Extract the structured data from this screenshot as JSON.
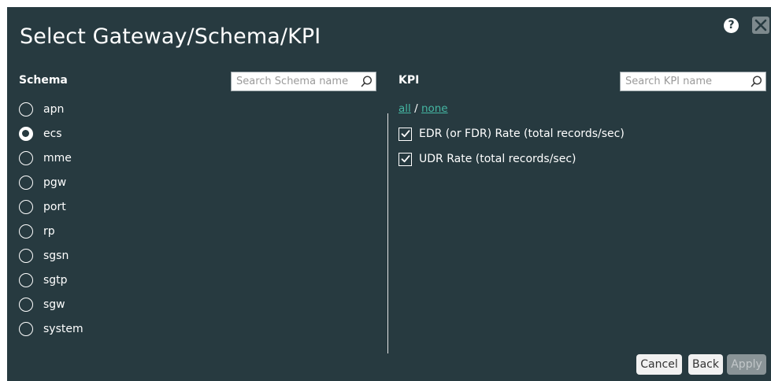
{
  "dialog": {
    "title": "Select Gateway/Schema/KPI",
    "help_icon": "question-circle-icon",
    "close_icon": "close-x-icon"
  },
  "schema": {
    "label": "Schema",
    "search_placeholder": "Search Schema name",
    "search_icon": "magnifier-icon",
    "options": [
      "apn",
      "ecs",
      "mme",
      "pgw",
      "port",
      "rp",
      "sgsn",
      "sgtp",
      "sgw",
      "system"
    ],
    "selected": "ecs"
  },
  "kpi": {
    "label": "KPI",
    "search_placeholder": "Search KPI name",
    "search_icon": "magnifier-icon",
    "select_all": "all",
    "separator": "/",
    "select_none": "none",
    "items": [
      {
        "label": "EDR (or FDR) Rate (total records/sec)",
        "checked": true
      },
      {
        "label": "UDR Rate (total records/sec)",
        "checked": true
      }
    ]
  },
  "buttons": {
    "cancel": "Cancel",
    "back": "Back",
    "apply": "Apply",
    "apply_disabled": true
  },
  "colors": {
    "background": "#273a40",
    "link": "#45b7a3",
    "text": "#ffffff"
  }
}
